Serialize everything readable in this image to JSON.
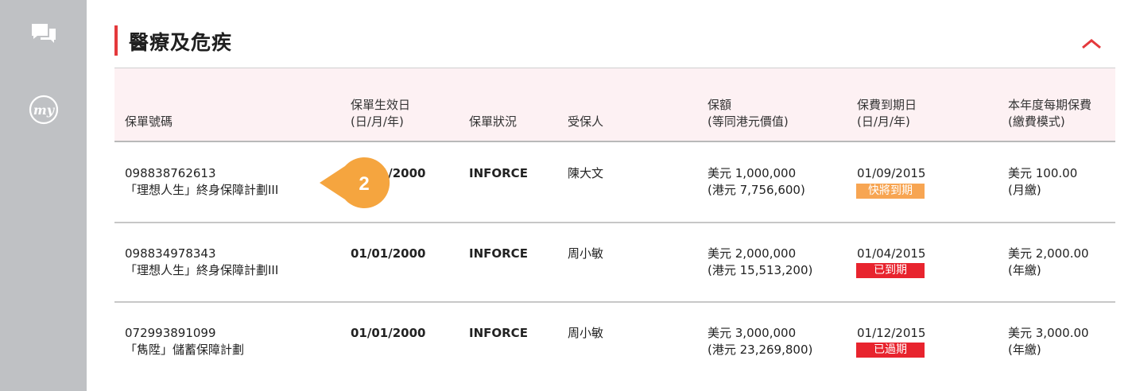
{
  "section": {
    "title": "醫療及危疾"
  },
  "table": {
    "headers": {
      "policy_no": "保單號碼",
      "effective_date_1": "保單生效日",
      "effective_date_2": "(日/月/年)",
      "status": "保單狀況",
      "insured": "受保人",
      "sum_1": "保額",
      "sum_2": "(等同港元價值)",
      "due_1": "保費到期日",
      "due_2": "(日/月/年)",
      "premium_1": "本年度每期保費",
      "premium_2": "(繳費模式)"
    },
    "rows": [
      {
        "policy_no": "098838762613",
        "plan": "「理想人生」終身保障計劃III",
        "effective_date": "01/01/2000",
        "status": "INFORCE",
        "insured": "陳大文",
        "sum_usd": "美元 1,000,000",
        "sum_hkd": "(港元 7,756,600)",
        "due_date": "01/09/2015",
        "due_badge": "快將到期",
        "premium": "美元 100.00",
        "mode": "(月繳)"
      },
      {
        "policy_no": "098834978343",
        "plan": "「理想人生」終身保障計劃III",
        "effective_date": "01/01/2000",
        "status": "INFORCE",
        "insured": "周小敏",
        "sum_usd": "美元 2,000,000",
        "sum_hkd": "(港元 15,513,200)",
        "due_date": "01/04/2015",
        "due_badge": "已到期",
        "premium": "美元 2,000.00",
        "mode": "(年繳)"
      },
      {
        "policy_no": "072993891099",
        "plan": "「雋陞」儲蓄保障計劃",
        "effective_date": "01/01/2000",
        "status": "INFORCE",
        "insured": "周小敏",
        "sum_usd": "美元 3,000,000",
        "sum_hkd": "(港元 23,269,800)",
        "due_date": "01/12/2015",
        "due_badge": "已過期",
        "premium": "美元 3,000.00",
        "mode": "(年繳)"
      }
    ]
  },
  "callout": {
    "number": "2",
    "color": "#f5a53f"
  },
  "sidebar": {
    "icons": [
      "chat-icon",
      "my-icon"
    ],
    "my_label": "my"
  },
  "colors": {
    "accent": "#e4393c",
    "badge_soon": "#f7a552",
    "badge_due": "#e8242e",
    "header_bg": "#fdf1f3"
  }
}
